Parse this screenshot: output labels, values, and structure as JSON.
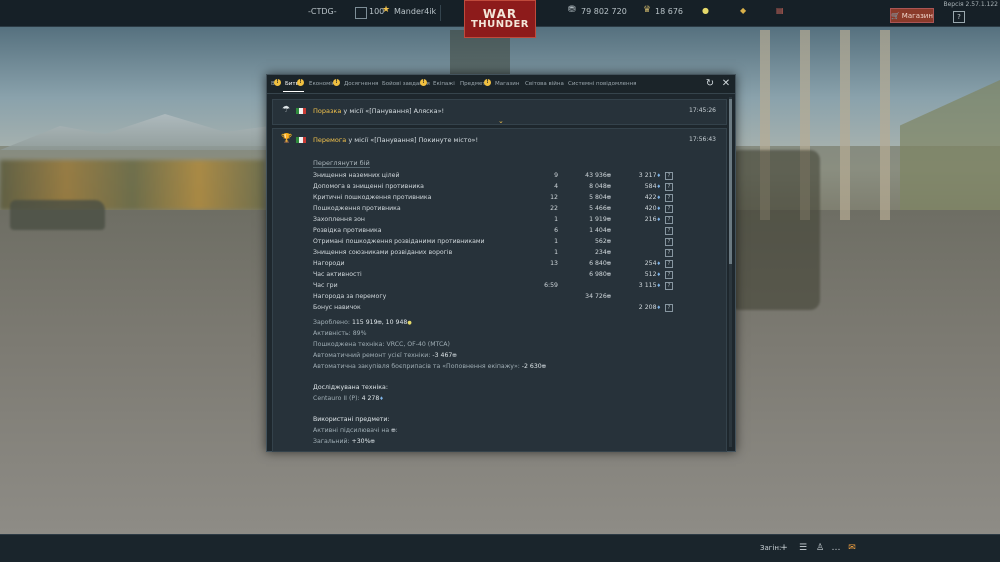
{
  "topbar": {
    "squad_tag": "-CTDG-",
    "level": "100",
    "username": "Mander4ik",
    "logo_line1": "WAR",
    "logo_line2": "THUNDER",
    "silver_lions": "79 802 720",
    "research_points": "18 676",
    "shop_label": "Магазин",
    "help_label": "?",
    "version": "Версія 2.57.1.122"
  },
  "tabs": [
    {
      "label": "Всі",
      "badge": "!"
    },
    {
      "label": "Битви",
      "badge": "!"
    },
    {
      "label": "Економіка",
      "badge": "!"
    },
    {
      "label": "Досягнення",
      "badge": ""
    },
    {
      "label": "Бойові завдання",
      "badge": "!"
    },
    {
      "label": "Екіпажі",
      "badge": ""
    },
    {
      "label": "Предмети",
      "badge": "!"
    },
    {
      "label": "Магазин",
      "badge": ""
    },
    {
      "label": "Світова війна",
      "badge": ""
    },
    {
      "label": "Системні повідомлення",
      "badge": ""
    }
  ],
  "messages": [
    {
      "status": "Поразка",
      "text": " у місії «[Панування] Аляска»!",
      "time": "17:45:26"
    },
    {
      "status": "Перемога",
      "text": " у місії «[Панування] Покинуте місто»!",
      "time": "17:56:43"
    }
  ],
  "review_label": "Переглянути бій",
  "stats": [
    {
      "name": "Знищення наземних цілей",
      "count": "9",
      "lions": "43 936",
      "rp": "3 217"
    },
    {
      "name": "Допомога в знищенні противника",
      "count": "4",
      "lions": "8 048",
      "rp": "584"
    },
    {
      "name": "Критичні пошкодження противника",
      "count": "12",
      "lions": "5 804",
      "rp": "422"
    },
    {
      "name": "Пошкодження противника",
      "count": "22",
      "lions": "5 466",
      "rp": "420"
    },
    {
      "name": "Захоплення зон",
      "count": "1",
      "lions": "1 919",
      "rp": "216"
    },
    {
      "name": "Розвідка противника",
      "count": "6",
      "lions": "1 404",
      "rp": ""
    },
    {
      "name": "Отримані пошкодження розвіданими противниками",
      "count": "1",
      "lions": "562",
      "rp": ""
    },
    {
      "name": "Знищення союзниками розвіданих ворогів",
      "count": "1",
      "lions": "234",
      "rp": ""
    },
    {
      "name": "Нагороди",
      "count": "13",
      "lions": "6 840",
      "rp": "254"
    },
    {
      "name": "Час активності",
      "count": "",
      "lions": "6 980",
      "rp": "512"
    },
    {
      "name": "Час гри",
      "count": "6:59",
      "lions": "",
      "rp": "3 115"
    },
    {
      "name": "Нагорода за перемогу",
      "count": "",
      "lions": "34 726",
      "rp": ""
    },
    {
      "name": "Бонус навичок",
      "count": "",
      "lions": "",
      "rp": "2 208"
    }
  ],
  "summary": {
    "earned_label": "Зароблено: ",
    "earned_lions": "115 919",
    "earned_sep": ", ",
    "earned_rp": "10 948",
    "activity": "Активність: 89%",
    "damaged": "Пошкоджена техніка: VRCC, OF-40 (MTCA)",
    "repair_label": "Автоматичний ремонт усієї техніки: ",
    "repair_value": "-3 467",
    "restock_label": "Автоматична закупівля боєприпасів та «Поповнення екіпажу»: ",
    "restock_value": "-2 630",
    "research_title": "Досліджувана техніка:",
    "research_vehicle": "Centauro II (P): ",
    "research_rp": "4 278",
    "items_title": "Використані предмети:",
    "boosters_label": "Активні підсилювачі на ",
    "total_label": "Загальний: ",
    "total_value": "+30%"
  },
  "bottombar": {
    "squad_label": "Загін:"
  }
}
